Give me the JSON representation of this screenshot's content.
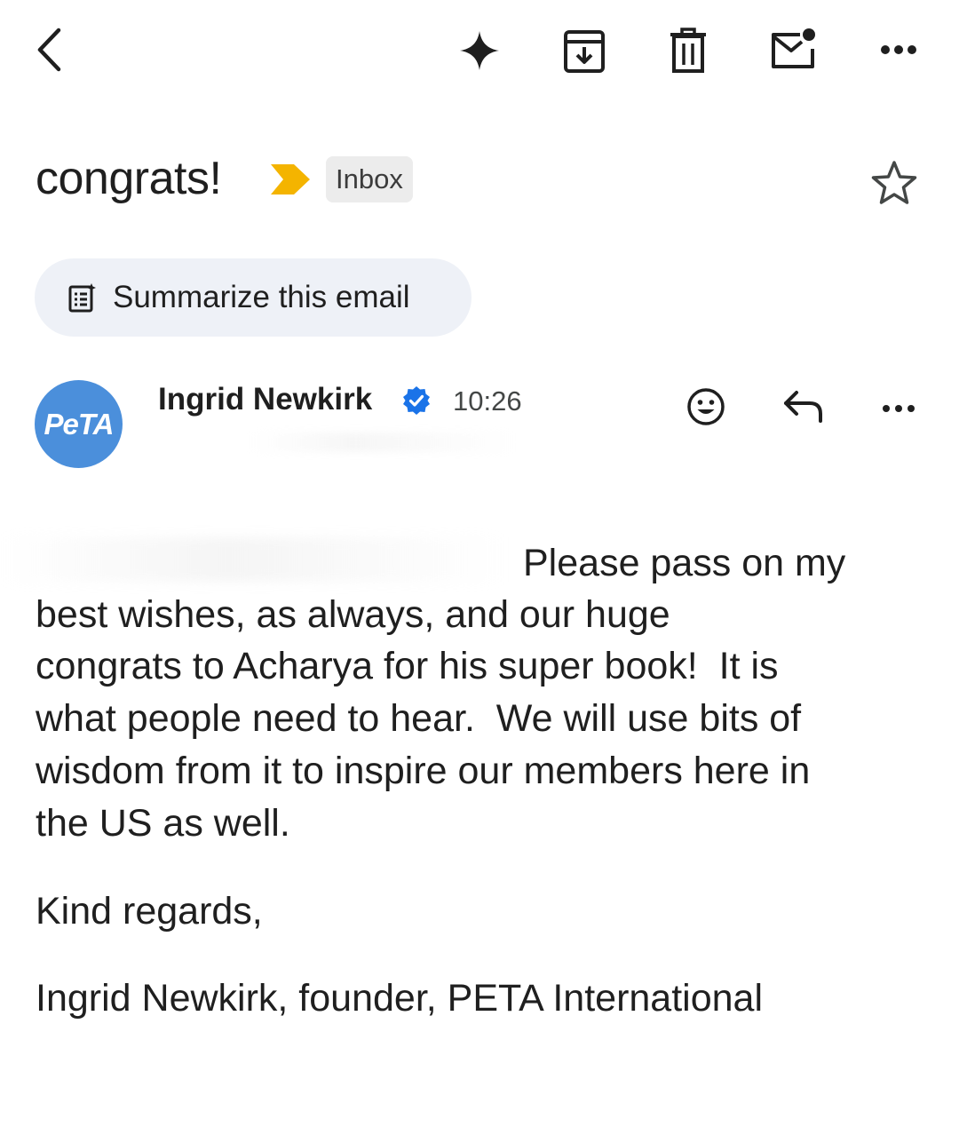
{
  "toolbar": {
    "back_icon": "chevron-left-icon",
    "gemini_icon": "sparkle-icon",
    "archive_icon": "archive-icon",
    "delete_icon": "trash-icon",
    "mark_unread_icon": "mail-unread-icon",
    "more_icon": "more-horizontal-icon"
  },
  "email": {
    "subject": "congrats!",
    "importance_color": "#f4b400",
    "label": "Inbox",
    "star_icon": "star-outline-icon"
  },
  "summarize": {
    "icon": "summary-doc-icon",
    "label": "Summarize this email"
  },
  "sender": {
    "avatar_text": "PeTA",
    "avatar_color": "#4b8fdb",
    "name": "Ingrid Newkirk",
    "verified_color": "#1a73e8",
    "time": "10:26",
    "emoji_icon": "emoji-react-icon",
    "reply_icon": "reply-icon",
    "more_icon": "more-horizontal-icon"
  },
  "body": {
    "first_line_visible": "Please pass on my",
    "lines": [
      "best wishes, as always, and our huge",
      "congrats to Acharya for his super book!  It is",
      "what people need to hear.  We will use bits of",
      "wisdom from it to inspire our members here in",
      "the US as well."
    ],
    "closing": "Kind regards,",
    "signature": "Ingrid Newkirk, founder, PETA International"
  }
}
